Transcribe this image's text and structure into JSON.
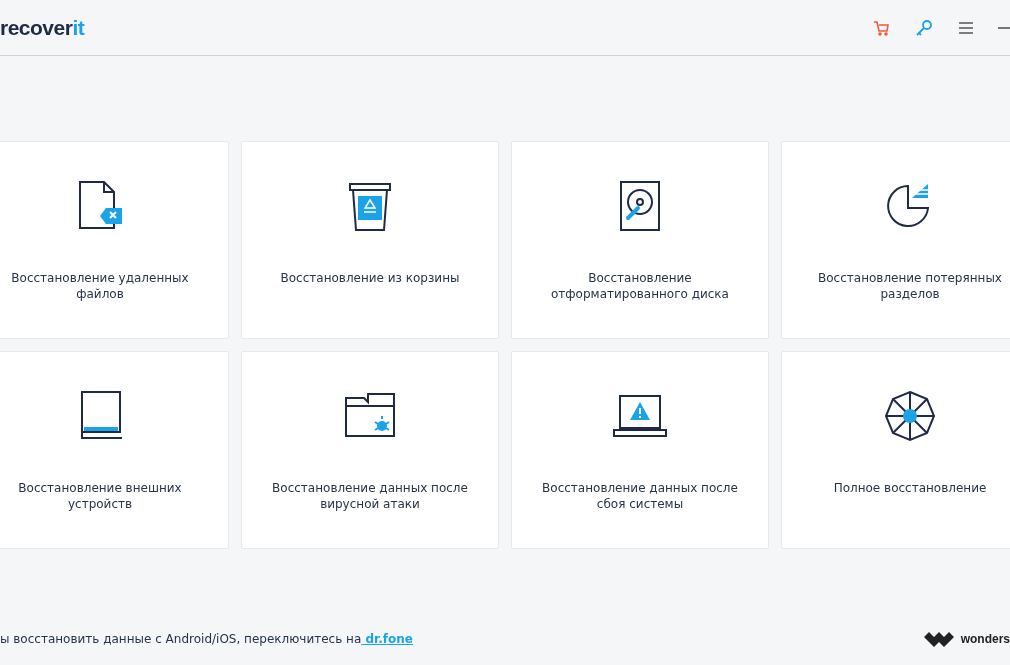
{
  "header": {
    "logo": {
      "main": "recover",
      "accent": "it"
    }
  },
  "cards": [
    {
      "kind": "deleted",
      "label": "Восстановление удаленных файлов"
    },
    {
      "kind": "trash",
      "label": "Восстановление из корзины"
    },
    {
      "kind": "disk",
      "label": "Восстановление отформатированного диска"
    },
    {
      "kind": "partition",
      "label": "Восстановление потерянных разделов"
    },
    {
      "kind": "external",
      "label": "Восстановление внешних устройств"
    },
    {
      "kind": "virus",
      "label": "Восстановление данных после вирусной атаки"
    },
    {
      "kind": "crash",
      "label": "Восстановление данных после сбоя системы"
    },
    {
      "kind": "full",
      "label": "Полное восстановление"
    }
  ],
  "footer": {
    "text": "ы восстановить данные с Android/iOS, переключитесь на",
    "link": " dr.fone",
    "brand": "wonders"
  }
}
